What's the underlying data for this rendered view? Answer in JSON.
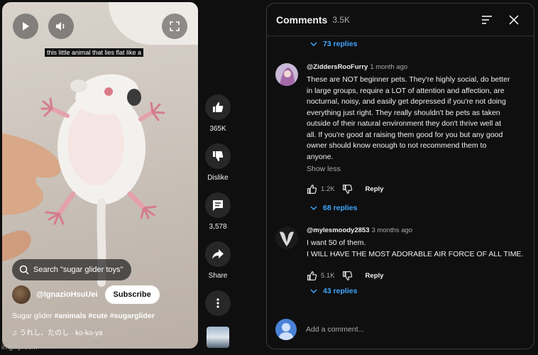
{
  "video": {
    "caption": "this little animal that lies flat like a",
    "search_chip": "Search \"sugar glider toys\"",
    "channel_name": "@IgnazioHsuUei",
    "subscribe_label": "Subscribe",
    "title_plain": "Sugar glider ",
    "title_tags": "#animals #cute #sugarglider",
    "music": "うれし、たのし · ko-ko-ya",
    "watermark": "imgflip.com"
  },
  "actions": {
    "like_count": "365K",
    "dislike_label": "Dislike",
    "comments_count": "3,578",
    "share_label": "Share"
  },
  "comments_panel": {
    "title": "Comments",
    "count": "3.5K",
    "top_replies": "73 replies",
    "comments": [
      {
        "author": "@ZiddersRooFurry",
        "time": "1 month ago",
        "lines": [
          "These are NOT beginner pets. They're highly social, do better",
          "in large groups, require a LOT of attention and affection, are",
          "nocturnal, noisy, and easily get depressed if you're not doing",
          "everything just right. They really shouldn't be pets as taken",
          "outside of their natural environment they don't thrive well at",
          "all. If you're good at raising them good for you but any good",
          "owner should know enough to not recommend them to",
          "anyone."
        ],
        "show_less": "Show less",
        "likes": "1.2K",
        "reply_label": "Reply",
        "replies": "68 replies"
      },
      {
        "author": "@mylesmoody2853",
        "time": "3 months ago",
        "lines": [
          "I want 50 of them.",
          "I WILL HAVE THE MOST ADORABLE AIR FORCE OF ALL TIME."
        ],
        "likes": "5.1K",
        "reply_label": "Reply",
        "replies": "43 replies"
      }
    ],
    "add_placeholder": "Add a comment..."
  }
}
